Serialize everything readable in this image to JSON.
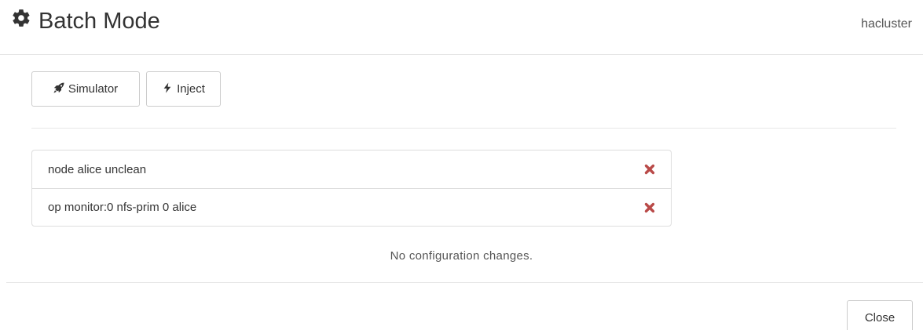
{
  "header": {
    "icon": "gear-icon",
    "title": "Batch Mode",
    "cluster": "hacluster"
  },
  "toolbar": {
    "simulator": {
      "icon": "rocket-icon",
      "label": "Simulator"
    },
    "inject": {
      "icon": "bolt-icon",
      "label": "Inject"
    }
  },
  "events": [
    {
      "text": "node alice unclean",
      "remove_icon": "remove-icon"
    },
    {
      "text": "op monitor:0 nfs-prim 0 alice",
      "remove_icon": "remove-icon"
    }
  ],
  "status": "No configuration changes.",
  "footer": {
    "close_label": "Close"
  },
  "colors": {
    "remove": "#b94a48",
    "border": "#dddddd",
    "text": "#333333"
  }
}
